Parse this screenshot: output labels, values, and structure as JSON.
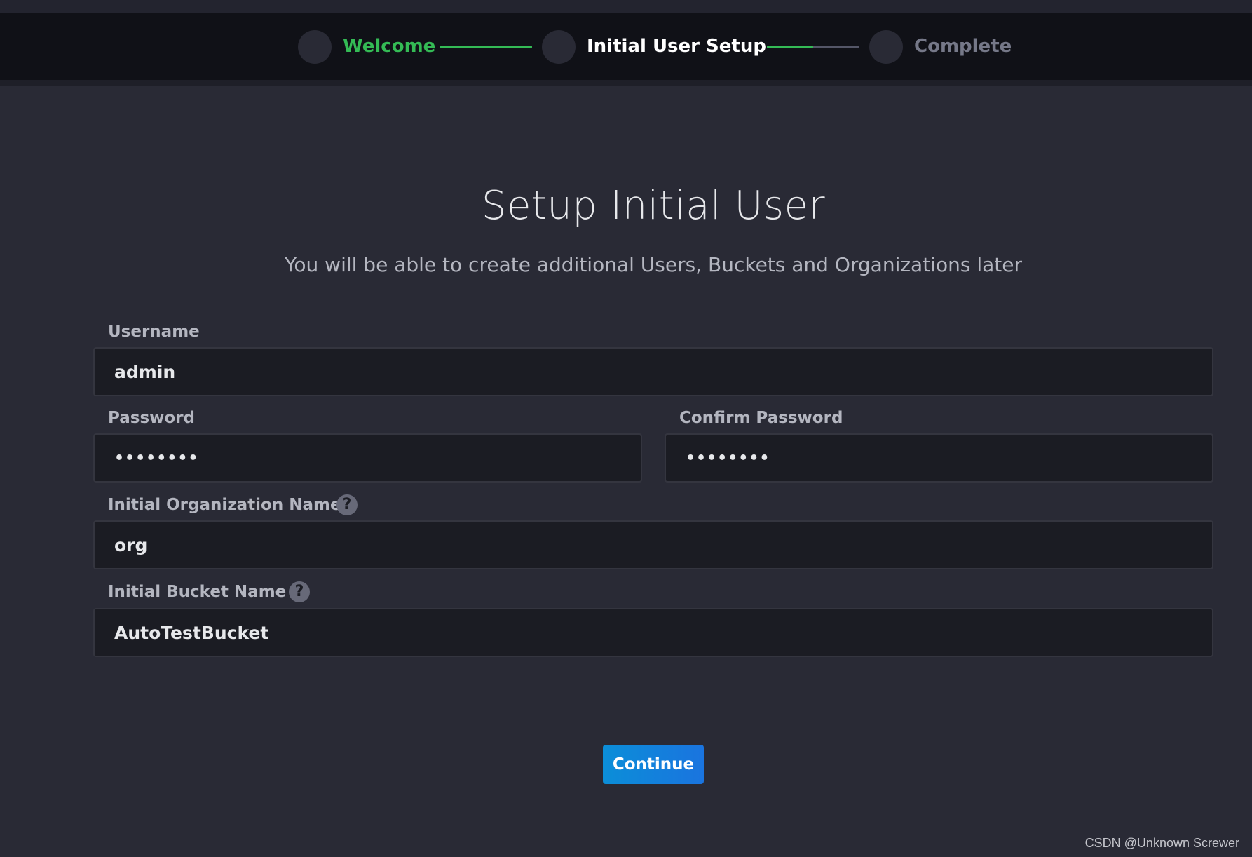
{
  "stepper": {
    "steps": [
      {
        "label": "Welcome",
        "state": "completed",
        "color": "#34bb55"
      },
      {
        "label": "Initial User Setup",
        "state": "active",
        "color": "#ffffff"
      },
      {
        "label": "Complete",
        "state": "pending",
        "color": "#757888"
      }
    ],
    "connectors": [
      {
        "progress": 1.0
      },
      {
        "progress": 0.5
      }
    ]
  },
  "page": {
    "title": "Setup Initial User",
    "subtitle": "You will be able to create additional Users, Buckets and Organizations later"
  },
  "form": {
    "username": {
      "label": "Username",
      "value": "admin"
    },
    "password": {
      "label": "Password",
      "value": "••••••••"
    },
    "confirm_password": {
      "label": "Confirm Password",
      "value": "••••••••"
    },
    "organization": {
      "label": "Initial Organization Name",
      "value": "org",
      "help_icon": "question-mark"
    },
    "bucket": {
      "label": "Initial Bucket Name",
      "value": "AutoTestBucket",
      "help_icon": "question-mark"
    },
    "help_glyph": "?",
    "continue_label": "Continue"
  },
  "colors": {
    "accent_green": "#34bb55",
    "button_blue": "#0b8ed8",
    "background": "#292a35"
  },
  "watermark": "CSDN @Unknown Screwer"
}
